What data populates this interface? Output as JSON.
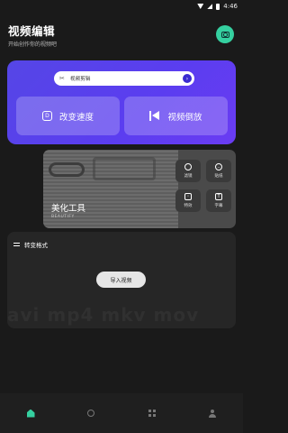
{
  "status": {
    "time": "4:46"
  },
  "header": {
    "title": "视频编辑",
    "subtitle": "开始创作你的视频吧"
  },
  "hero": {
    "search_label": "视频剪辑",
    "btn_speed": "改变速度",
    "btn_reverse": "视频倒放"
  },
  "beauty": {
    "title": "美化工具",
    "subtitle": "BEAUTIFY",
    "tools": [
      {
        "label": "滤镜",
        "icon": "filter-icon"
      },
      {
        "label": "贴纸",
        "icon": "sticker-icon"
      },
      {
        "label": "特效",
        "icon": "effect-icon"
      },
      {
        "label": "字幕",
        "icon": "subtitle-icon"
      }
    ]
  },
  "convert": {
    "title": "转变格式",
    "import_label": "导入视频",
    "watermark": "avi mp4 mkv mov"
  },
  "nav": {
    "items": [
      {
        "icon": "home-icon",
        "active": true
      },
      {
        "icon": "disc-icon",
        "active": false
      },
      {
        "icon": "grid-icon",
        "active": false
      },
      {
        "icon": "user-icon",
        "active": false
      }
    ]
  },
  "colors": {
    "accent": "#35d0a0",
    "hero": "#5546e6",
    "background": "#1a1a1a"
  }
}
